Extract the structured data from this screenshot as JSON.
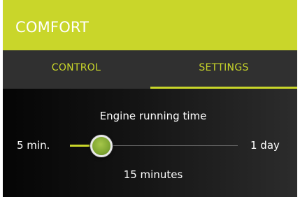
{
  "header": {
    "title": "COMFORT",
    "accent_color": "#c9d62a"
  },
  "tabs": [
    {
      "label": "CONTROL",
      "selected": false
    },
    {
      "label": "SETTINGS",
      "selected": true
    }
  ],
  "setting": {
    "title": "Engine running time",
    "min_label": "5 min.",
    "max_label": "1 day",
    "value_label": "15 minutes",
    "slider_fraction": 0.12
  }
}
